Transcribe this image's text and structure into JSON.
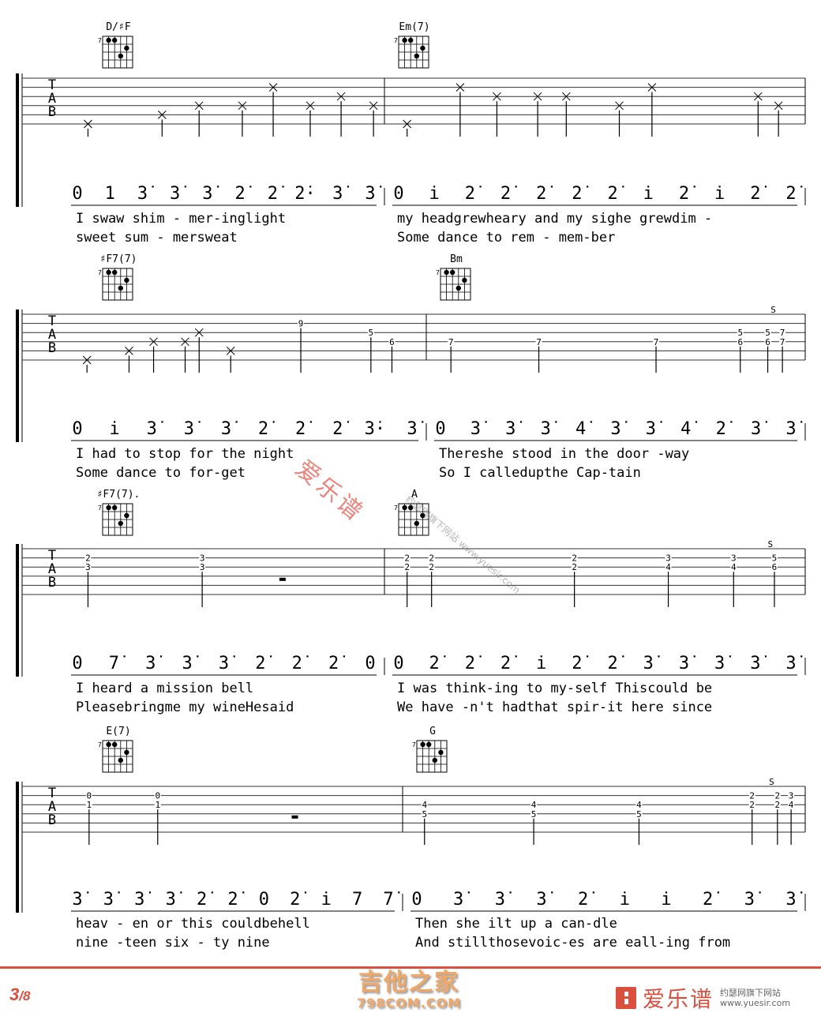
{
  "document": {
    "type": "guitar tablature with numbered notation",
    "page": {
      "current": "3",
      "total": "/8"
    },
    "footer": {
      "site_logo_cn": "吉他之家",
      "site_logo_en": "798COM.COM",
      "brand_name": "爱乐谱",
      "brand_sub_cn": "约瑟网旗下网站",
      "brand_sub_url": "www.yuesir.com"
    },
    "watermark": {
      "main": "爱乐谱",
      "sub": "约瑟网旗下网站 www.yuesir.com"
    },
    "colors": {
      "accent": "#d9503f",
      "logo": "#f0a868",
      "ink": "#000000"
    }
  },
  "tab_clef": [
    "T",
    "A",
    "B"
  ],
  "systems": [
    {
      "measures": [
        {
          "chord": "D/#F",
          "chord_display": "D/♯F",
          "tab": [
            {
              "p": 0.06,
              "frets": [
                {
                  "s": 5,
                  "f": "x"
                }
              ]
            },
            {
              "p": 0.3,
              "frets": [
                {
                  "s": 4,
                  "f": "x"
                }
              ]
            },
            {
              "p": 0.42,
              "frets": [
                {
                  "s": 3,
                  "f": "x"
                }
              ]
            },
            {
              "p": 0.56,
              "frets": [
                {
                  "s": 3,
                  "f": "x"
                }
              ]
            },
            {
              "p": 0.66,
              "frets": [
                {
                  "s": 1,
                  "f": "x"
                }
              ]
            },
            {
              "p": 0.78,
              "frets": [
                {
                  "s": 3,
                  "f": "x"
                }
              ]
            },
            {
              "p": 0.88,
              "frets": [
                {
                  "s": 2,
                  "f": "x"
                }
              ]
            },
            {
              "p": 0.985,
              "frets": [
                {
                  "s": 3,
                  "f": "x"
                }
              ]
            }
          ],
          "notes": [
            "0",
            "1",
            "3̇",
            "3̇",
            "3̇",
            "2̇",
            "2̇",
            "2̇·",
            "3̇",
            "3̇"
          ],
          "lyrics1": "I  swaw  shim  -  mer-inglight",
          "lyrics2": "sweet      sum - mersweat"
        },
        {
          "chord": "Em(7)",
          "tab": [
            {
              "p": 0.04,
              "frets": [
                {
                  "s": 5,
                  "f": "x"
                }
              ]
            },
            {
              "p": 0.17,
              "frets": [
                {
                  "s": 1,
                  "f": "x"
                }
              ]
            },
            {
              "p": 0.26,
              "frets": [
                {
                  "s": 2,
                  "f": "x"
                }
              ]
            },
            {
              "p": 0.36,
              "frets": [
                {
                  "s": 2,
                  "f": "x"
                }
              ]
            },
            {
              "p": 0.43,
              "frets": [
                {
                  "s": 2,
                  "f": "x"
                }
              ]
            },
            {
              "p": 0.56,
              "frets": [
                {
                  "s": 3,
                  "f": "x"
                }
              ]
            },
            {
              "p": 0.64,
              "frets": [
                {
                  "s": 1,
                  "f": "x"
                }
              ]
            },
            {
              "p": 0.9,
              "frets": [
                {
                  "s": 2,
                  "f": "x"
                }
              ]
            },
            {
              "p": 0.95,
              "frets": [
                {
                  "s": 3,
                  "f": "x"
                }
              ]
            }
          ],
          "notes": [
            "0",
            "i̇",
            "2̇",
            "2̇",
            "2̇",
            "2̇",
            "2̇",
            "i̇",
            "2̇",
            "i̇",
            "2̇",
            "2̇"
          ],
          "lyrics1": "my headgrewheary     and my sighe  grewdim -",
          "lyrics2": "Some    dance  to   rem  -  mem-ber"
        }
      ]
    },
    {
      "measures": [
        {
          "chord": "#F7(7)",
          "chord_display": "♯F7(7)",
          "tab": [
            {
              "p": 0.05,
              "frets": [
                {
                  "s": 5,
                  "f": "x"
                }
              ]
            },
            {
              "p": 0.17,
              "frets": [
                {
                  "s": 4,
                  "f": "x"
                }
              ]
            },
            {
              "p": 0.24,
              "frets": [
                {
                  "s": 3,
                  "f": "x"
                }
              ]
            },
            {
              "p": 0.33,
              "frets": [
                {
                  "s": 3,
                  "f": "x"
                }
              ]
            },
            {
              "p": 0.37,
              "frets": [
                {
                  "s": 2,
                  "f": "x"
                }
              ]
            },
            {
              "p": 0.46,
              "frets": [
                {
                  "s": 4,
                  "f": "x"
                }
              ]
            },
            {
              "p": 0.66,
              "frets": [
                {
                  "s": 1,
                  "f": "9"
                }
              ]
            },
            {
              "p": 0.86,
              "frets": [
                {
                  "s": 2,
                  "f": "5"
                }
              ]
            },
            {
              "p": 0.92,
              "frets": [
                {
                  "s": 3,
                  "f": "6"
                }
              ]
            }
          ],
          "notes": [
            "0",
            "i̇",
            "3̇",
            "3̇",
            "3̇",
            "2̇",
            "2̇",
            "2̇",
            "3̇·",
            "3̇"
          ],
          "lyrics1": "I  had  to  stop   for the night",
          "lyrics2": "Some    dance to        for-get"
        },
        {
          "chord": "Bm",
          "tab": [
            {
              "p": 0.05,
              "frets": [
                {
                  "s": 3,
                  "f": "7"
                }
              ]
            },
            {
              "p": 0.29,
              "frets": [
                {
                  "s": 3,
                  "f": "7"
                }
              ]
            },
            {
              "p": 0.61,
              "frets": [
                {
                  "s": 3,
                  "f": "7"
                }
              ]
            },
            {
              "p": 0.84,
              "frets": [
                {
                  "s": 2,
                  "f": "5"
                },
                {
                  "s": 3,
                  "f": "6"
                }
              ]
            },
            {
              "p": 0.915,
              "frets": [
                {
                  "s": 2,
                  "f": "5"
                },
                {
                  "s": 3,
                  "f": "6"
                }
              ]
            },
            {
              "p": 0.955,
              "frets": [
                {
                  "s": 2,
                  "f": "7"
                },
                {
                  "s": 3,
                  "f": "7"
                }
              ]
            }
          ],
          "slide_mark": "S",
          "notes": [
            "0",
            "3̇",
            "3̇",
            "3̇",
            "4̇",
            "3̇",
            "3̇",
            "4̇",
            "2̇",
            "3̇",
            "3̇"
          ],
          "lyrics1": "Thereshe  stood   in the  door -way",
          "lyrics2": "So  I  calledupthe Cap-tain"
        }
      ]
    },
    {
      "measures": [
        {
          "chord": "#F7(7).",
          "chord_display": "♯F7(7).",
          "tab": [
            {
              "p": 0.06,
              "frets": [
                {
                  "s": 1,
                  "f": "2"
                },
                {
                  "s": 2,
                  "f": "3"
                }
              ]
            },
            {
              "p": 0.43,
              "frets": [
                {
                  "s": 1,
                  "f": "3"
                },
                {
                  "s": 2,
                  "f": "3"
                }
              ]
            }
          ],
          "rest": true,
          "notes": [
            "0",
            "7̇",
            "3̇",
            "3̇",
            "3̇",
            "2̇",
            "2̇",
            "2̇",
            "0"
          ],
          "lyrics1": "I  heard a mission      bell",
          "lyrics2": "Pleasebringme   my    wineHesaid"
        },
        {
          "chord": "A",
          "tab": [
            {
              "p": 0.04,
              "frets": [
                {
                  "s": 1,
                  "f": "2"
                },
                {
                  "s": 2,
                  "f": "2"
                }
              ]
            },
            {
              "p": 0.1,
              "frets": [
                {
                  "s": 1,
                  "f": "2"
                },
                {
                  "s": 2,
                  "f": "2"
                }
              ]
            },
            {
              "p": 0.45,
              "frets": [
                {
                  "s": 1,
                  "f": "2"
                },
                {
                  "s": 2,
                  "f": "2"
                }
              ]
            },
            {
              "p": 0.68,
              "frets": [
                {
                  "s": 1,
                  "f": "3"
                },
                {
                  "s": 2,
                  "f": "4"
                }
              ]
            },
            {
              "p": 0.84,
              "frets": [
                {
                  "s": 1,
                  "f": "3"
                },
                {
                  "s": 2,
                  "f": "4"
                }
              ]
            },
            {
              "p": 0.94,
              "frets": [
                {
                  "s": 1,
                  "f": "5"
                },
                {
                  "s": 2,
                  "f": "6"
                }
              ]
            }
          ],
          "slide_mark": "S",
          "notes": [
            "0",
            "2̇",
            "2̇",
            "2̇",
            "i̇",
            "2̇",
            "2̇",
            "3̇",
            "3̇",
            "3̇",
            "3̇",
            "3̇"
          ],
          "lyrics1": "I was  think-ing to  my-self   Thiscould  be",
          "lyrics2": "We have -n't  hadthat    spir-it    here since"
        }
      ]
    },
    {
      "measures": [
        {
          "chord": "E(7)",
          "tab": [
            {
              "p": 0.06,
              "frets": [
                {
                  "s": 1,
                  "f": "0"
                },
                {
                  "s": 2,
                  "f": "1"
                }
              ]
            },
            {
              "p": 0.27,
              "frets": [
                {
                  "s": 1,
                  "f": "0"
                },
                {
                  "s": 2,
                  "f": "1"
                }
              ]
            }
          ],
          "rest": true,
          "notes": [
            "3̇",
            "3̇",
            "3̇",
            "3̇",
            "2̇",
            "2̇",
            "0",
            "2̇",
            "i̇",
            "7",
            "7̇"
          ],
          "lyrics1": "heav - en  or   this  couldbehell",
          "lyrics2": "nine -teen six  - ty   nine"
        },
        {
          "chord": "G",
          "tab": [
            {
              "p": 0.04,
              "frets": [
                {
                  "s": 2,
                  "f": "4"
                },
                {
                  "s": 3,
                  "f": "5"
                }
              ]
            },
            {
              "p": 0.32,
              "frets": [
                {
                  "s": 2,
                  "f": "4"
                },
                {
                  "s": 3,
                  "f": "5"
                }
              ]
            },
            {
              "p": 0.59,
              "frets": [
                {
                  "s": 2,
                  "f": "4"
                },
                {
                  "s": 3,
                  "f": "5"
                }
              ]
            },
            {
              "p": 0.88,
              "frets": [
                {
                  "s": 1,
                  "f": "2"
                },
                {
                  "s": 2,
                  "f": "2"
                }
              ]
            },
            {
              "p": 0.945,
              "frets": [
                {
                  "s": 1,
                  "f": "2"
                },
                {
                  "s": 2,
                  "f": "2"
                }
              ]
            },
            {
              "p": 0.98,
              "frets": [
                {
                  "s": 1,
                  "f": "3"
                },
                {
                  "s": 2,
                  "f": "4"
                }
              ]
            }
          ],
          "slide_mark": "S",
          "notes": [
            "0",
            "3̇",
            "3̇",
            "3̇",
            "2̇",
            "i̇",
            "i̇",
            "2̇",
            "3̇",
            "3̇"
          ],
          "lyrics1": "Then       she       ilt up  a   can-dle",
          "lyrics2": "And stillthosevoic-es are eall-ing from"
        }
      ]
    }
  ]
}
